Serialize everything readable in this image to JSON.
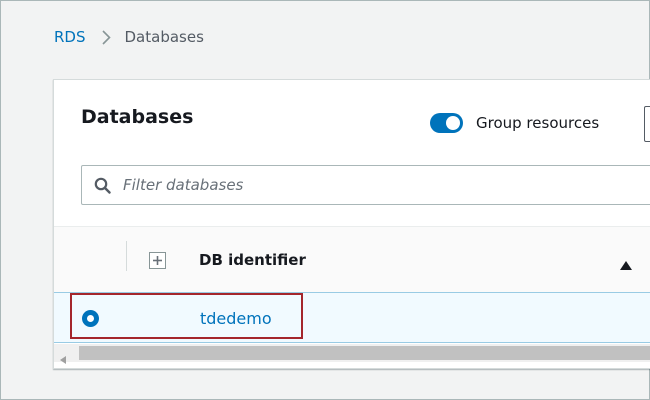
{
  "breadcrumb": {
    "root": "RDS",
    "current": "Databases"
  },
  "panel": {
    "title": "Databases",
    "group_toggle_label": "Group resources",
    "group_toggle_on": true
  },
  "search": {
    "placeholder": "Filter databases",
    "value": ""
  },
  "table": {
    "columns": [
      "DB identifier"
    ],
    "sort": "ascending",
    "rows": [
      {
        "db_identifier": "tdedemo",
        "selected": true
      }
    ]
  },
  "colors": {
    "accent": "#0073bb",
    "highlight": "#a4262c",
    "selected_row_bg": "#f1faff"
  },
  "icons": [
    "chevron-right-icon",
    "search-icon",
    "expand-plus-icon",
    "sort-up-icon",
    "scroll-left-icon"
  ]
}
